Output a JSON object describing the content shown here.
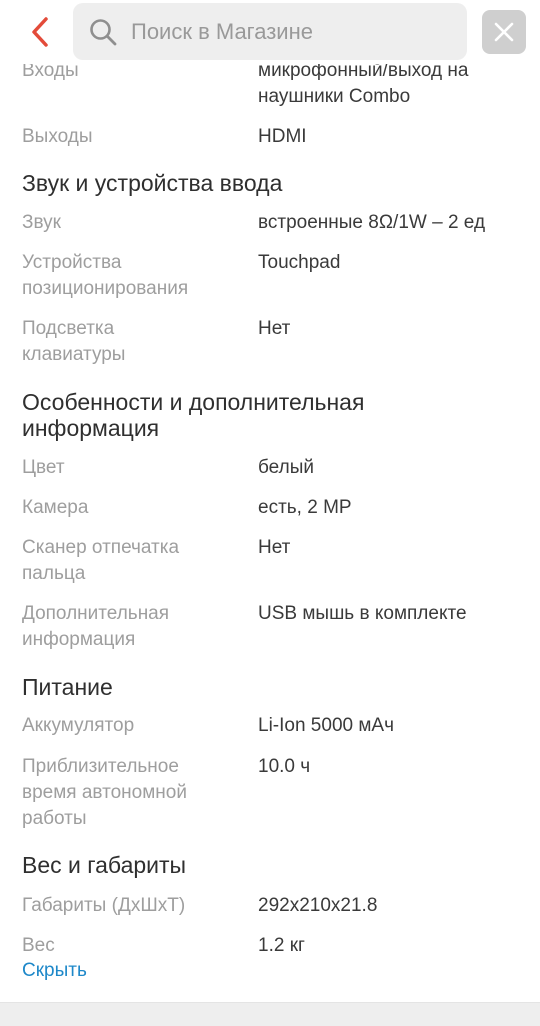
{
  "header": {
    "search_placeholder": "Поиск в Магазине",
    "icons": {
      "back": "chevron-left-icon",
      "search": "search-icon",
      "close": "close-icon"
    },
    "accent_color": "#e34b3a"
  },
  "specs": {
    "partial_top": {
      "label": "Входы",
      "value_line1": "микрофонный/выход на",
      "value_line2": "наушники Combo"
    },
    "outputs": {
      "label": "Выходы",
      "value": "HDMI"
    },
    "section_sound": "Звук и устройства ввода",
    "sound": {
      "label": "Звук",
      "value": "встроенные 8Ω/1W – 2 ед"
    },
    "pointing": {
      "label_line1": "Устройства",
      "label_line2": "позиционирования",
      "value": "Touchpad"
    },
    "backlight": {
      "label_line1": "Подсветка",
      "label_line2": "клавиатуры",
      "value": "Нет"
    },
    "section_extra_line1": "Особенности и дополнительная",
    "section_extra_line2": "информация",
    "color": {
      "label": "Цвет",
      "value": "белый"
    },
    "camera": {
      "label": "Камера",
      "value": "есть, 2 MP"
    },
    "fingerprint": {
      "label_line1": "Сканер отпечатка",
      "label_line2": "пальца",
      "value": "Нет"
    },
    "extra_info": {
      "label_line1": "Дополнительная",
      "label_line2": "информация",
      "value": "USB мышь в комплекте"
    },
    "section_power": "Питание",
    "battery": {
      "label": "Аккумулятор",
      "value": "Li-Ion 5000 мАч"
    },
    "runtime": {
      "label_line1": "Приблизительное",
      "label_line2": "время автономной",
      "label_line3": "работы",
      "value": "10.0 ч"
    },
    "section_size": "Вес и габариты",
    "dimensions": {
      "label": "Габариты (ДхШхТ)",
      "value": "292x210x21.8"
    },
    "weight": {
      "label": "Вес",
      "value": "1.2 кг"
    }
  },
  "hide_link": "Скрыть",
  "link_color": "#1e88c9"
}
